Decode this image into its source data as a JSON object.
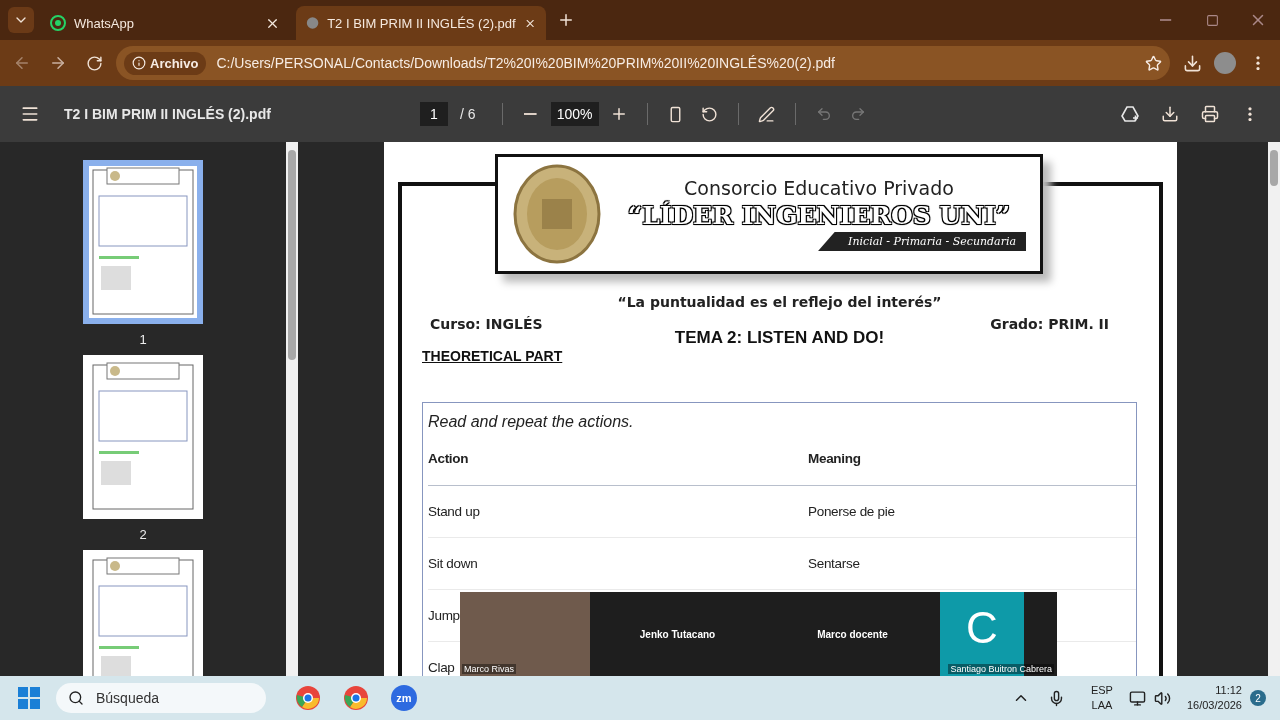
{
  "browser": {
    "tabs": [
      {
        "title": "WhatsApp",
        "kind": "whatsapp",
        "selected": false
      },
      {
        "title": "T2 I BIM PRIM II INGLÉS (2).pdf",
        "kind": "pdf",
        "selected": true
      }
    ],
    "address": {
      "chip": "Archivo",
      "url": "C:/Users/PERSONAL/Contacts/Downloads/T2%20I%20BIM%20PRIM%20II%20INGLÉS%20(2).pdf"
    }
  },
  "pdf_toolbar": {
    "title": "T2 I BIM PRIM II INGLÉS (2).pdf",
    "page": "1",
    "page_count": "/ 6",
    "zoom": "100%"
  },
  "thumbnails": [
    {
      "label": "1",
      "selected": true
    },
    {
      "label": "2",
      "selected": false
    },
    {
      "selected": false
    }
  ],
  "document": {
    "org": "Consorcio Educativo Privado",
    "school": "“LÍDER INGENIEROS UNI”",
    "levels": "Inicial - Primaria - Secundaria",
    "motto": "“La puntualidad es el reflejo del interés”",
    "course": "Curso: INGLÉS",
    "grade": "Grado: PRIM. II",
    "topic": "TEMA 2: LISTEN AND DO!",
    "section": "THEORETICAL PART",
    "instruction": "Read and repeat the actions.",
    "columns": [
      "Action",
      "Meaning"
    ],
    "rows": [
      [
        "Stand up",
        "Ponerse de pie"
      ],
      [
        "Sit down",
        "Sentarse"
      ],
      [
        "Jump"
      ],
      [
        "Clap"
      ]
    ]
  },
  "meeting": {
    "tiles": [
      {
        "kind": "video",
        "name": "Marco Rivas"
      },
      {
        "kind": "name",
        "name": "Jenko Tutacano"
      },
      {
        "kind": "name",
        "name": "Marco docente"
      },
      {
        "kind": "avatar",
        "initial": "C",
        "name": "Santiago Buitron Cabrera"
      }
    ]
  },
  "taskbar": {
    "search_placeholder": "Búsqueda",
    "apps": [
      {
        "kind": "chrome"
      },
      {
        "kind": "chrome"
      },
      {
        "kind": "zoom",
        "label": "zm"
      }
    ],
    "language": [
      "ESP",
      "LAA"
    ],
    "time": "11:12",
    "date": "16/03/2026",
    "notifications": "2"
  }
}
